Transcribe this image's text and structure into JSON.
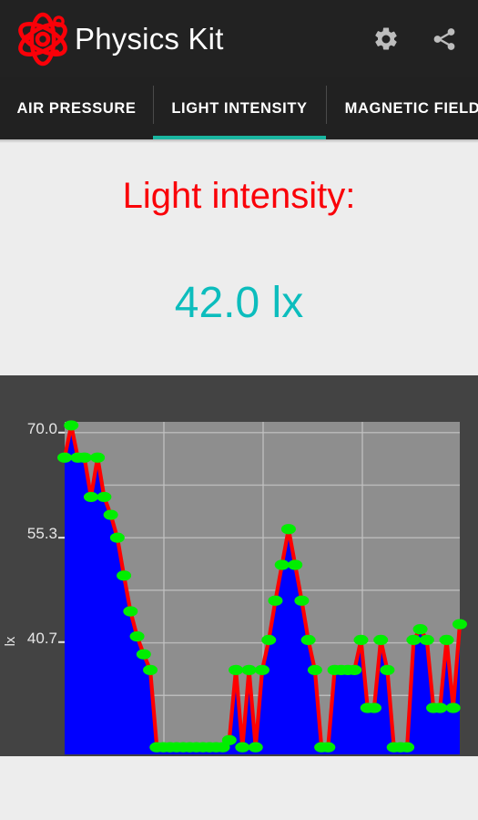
{
  "app": {
    "title": "Physics Kit",
    "logo_icon": "atom-icon",
    "logo_color": "#fa0008",
    "bar_background": "#222222",
    "actions": [
      {
        "icon": "gear-icon",
        "name": "settings"
      },
      {
        "icon": "share-icon",
        "name": "share"
      }
    ]
  },
  "tabs": {
    "selected_index": 1,
    "indicator_color": "#19b5a0",
    "items": [
      {
        "label": "AIR PRESSURE"
      },
      {
        "label": "LIGHT INTENSITY"
      },
      {
        "label": "MAGNETIC FIELD"
      }
    ]
  },
  "readout": {
    "label": "Light intensity:",
    "label_color": "#fa0008",
    "value": "42.0 lx",
    "value_color": "#0cbdbd"
  },
  "chart_data": {
    "type": "area",
    "title": "",
    "xlabel": "",
    "ylabel": "lx",
    "ytick_labels": [
      "70.0",
      "55.3",
      "40.7"
    ],
    "ytick_values": [
      70.0,
      55.3,
      40.7
    ],
    "ylim": [
      25.0,
      71.5
    ],
    "xlim": [
      0,
      60
    ],
    "grid": true,
    "legend": null,
    "plot_bg": "#8e8e8e",
    "card_bg": "#434343",
    "gridline_color": "#c4c4c4",
    "line_color": "#ff0000",
    "fill_color": "#0000ff",
    "point_color": "#00ee00",
    "series": [
      {
        "name": "Light intensity",
        "x": [
          0,
          1,
          2,
          3,
          4,
          5,
          6,
          7,
          8,
          9,
          10,
          11,
          12,
          13,
          14,
          15,
          16,
          17,
          18,
          19,
          20,
          21,
          22,
          23,
          24,
          25,
          26,
          27,
          28,
          29,
          30,
          31,
          32,
          33,
          34,
          35,
          36,
          37,
          38,
          39,
          40,
          41,
          42,
          43,
          44,
          45,
          46,
          47,
          48,
          49,
          50,
          51,
          52,
          53,
          54,
          55,
          56,
          57,
          58,
          59,
          60
        ],
        "values": [
          66.5,
          71.0,
          66.5,
          66.5,
          61.0,
          66.5,
          61.0,
          58.5,
          55.3,
          50.0,
          45.0,
          41.5,
          39.0,
          36.8,
          26.0,
          26.0,
          26.0,
          26.0,
          26.0,
          26.0,
          26.0,
          26.0,
          26.0,
          26.0,
          26.0,
          27.0,
          36.8,
          26.0,
          36.8,
          26.0,
          36.8,
          41.0,
          46.5,
          51.5,
          56.5,
          51.5,
          46.5,
          41.0,
          36.8,
          26.0,
          26.0,
          36.8,
          36.8,
          36.8,
          36.8,
          41.0,
          31.5,
          31.5,
          41.0,
          36.8,
          26.0,
          26.0,
          26.0,
          41.0,
          42.5,
          41.0,
          31.5,
          31.5,
          41.0,
          31.5,
          43.2
        ]
      }
    ]
  }
}
